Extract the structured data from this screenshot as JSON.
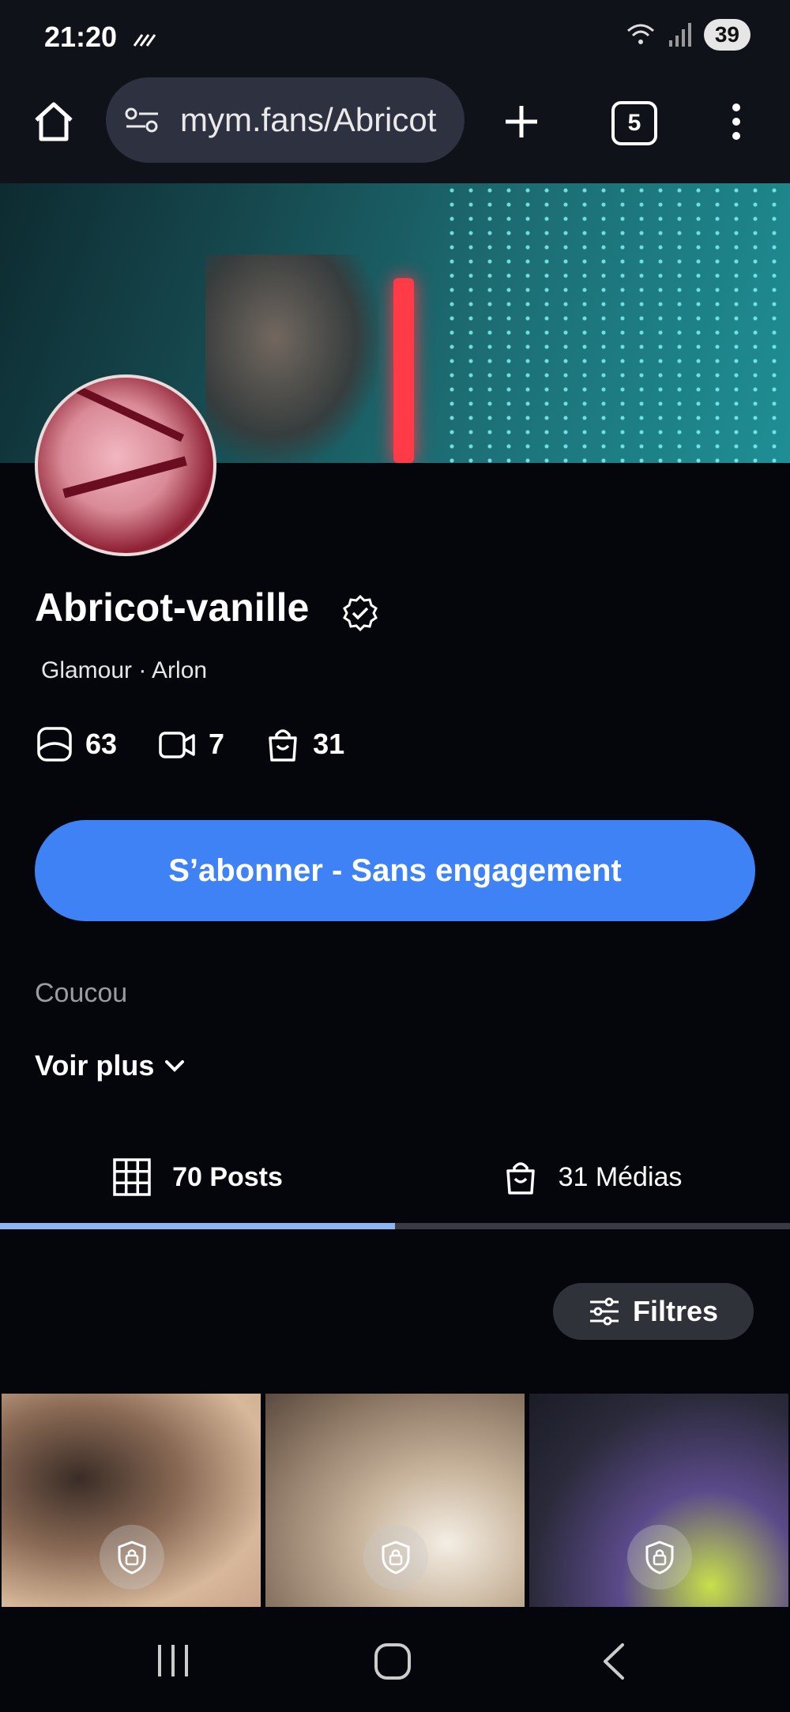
{
  "status_bar": {
    "time": "21:20",
    "battery": "39"
  },
  "browser": {
    "url": "mym.fans/Abricot",
    "tab_count": "5"
  },
  "profile": {
    "name": "Abricot-vanille",
    "subtitle": "Glamour · Arlon",
    "stats": {
      "photos": "63",
      "videos": "7",
      "medias": "31"
    },
    "subscribe_label": "S’abonner - Sans engagement",
    "bio": "Coucou",
    "see_more": "Voir plus"
  },
  "tabs": [
    {
      "label": "70 Posts",
      "active": true
    },
    {
      "label": "31 Médias",
      "active": false
    }
  ],
  "filters_label": "Filtres",
  "colors": {
    "accent": "#3f82f5",
    "background": "#05060b",
    "tab_indicator": "#8fb4f4"
  }
}
